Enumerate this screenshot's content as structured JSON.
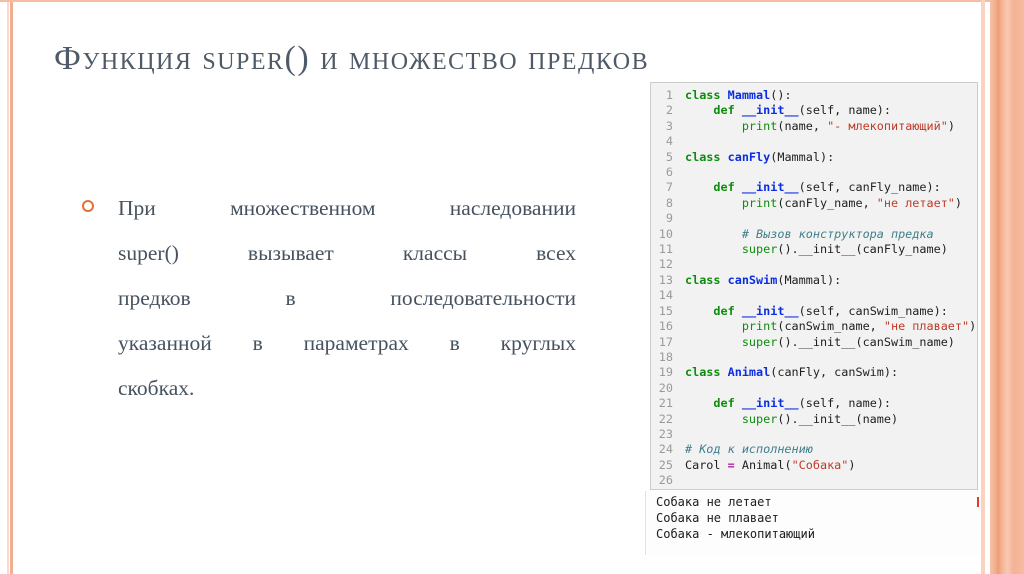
{
  "slide": {
    "title": "Функция super() и множество предков",
    "bullet": {
      "lines": [
        "При множественном наследовании",
        "super() вызывает классы всех",
        "предков в последовательности",
        "указанной в параметрах в круглых",
        "скобках."
      ]
    }
  },
  "code_panel": {
    "lines": [
      {
        "n": "1",
        "tokens": [
          {
            "t": "class",
            "c": "kw"
          },
          {
            "t": " ",
            "c": "pl"
          },
          {
            "t": "Mammal",
            "c": "cls"
          },
          {
            "t": "():",
            "c": "pl"
          }
        ]
      },
      {
        "n": "2",
        "tokens": [
          {
            "t": "    ",
            "c": "pl"
          },
          {
            "t": "def",
            "c": "kw"
          },
          {
            "t": " ",
            "c": "pl"
          },
          {
            "t": "__init__",
            "c": "fn"
          },
          {
            "t": "(self, name):",
            "c": "pl"
          }
        ]
      },
      {
        "n": "3",
        "tokens": [
          {
            "t": "        ",
            "c": "pl"
          },
          {
            "t": "print",
            "c": "bi"
          },
          {
            "t": "(name, ",
            "c": "pl"
          },
          {
            "t": "\"- млекопитающий\"",
            "c": "str"
          },
          {
            "t": ")",
            "c": "pl"
          }
        ]
      },
      {
        "n": "4",
        "tokens": []
      },
      {
        "n": "5",
        "tokens": [
          {
            "t": "class",
            "c": "kw"
          },
          {
            "t": " ",
            "c": "pl"
          },
          {
            "t": "canFly",
            "c": "cls"
          },
          {
            "t": "(Mammal):",
            "c": "pl"
          }
        ]
      },
      {
        "n": "6",
        "tokens": []
      },
      {
        "n": "7",
        "tokens": [
          {
            "t": "    ",
            "c": "pl"
          },
          {
            "t": "def",
            "c": "kw"
          },
          {
            "t": " ",
            "c": "pl"
          },
          {
            "t": "__init__",
            "c": "fn"
          },
          {
            "t": "(self, canFly_name):",
            "c": "pl"
          }
        ]
      },
      {
        "n": "8",
        "tokens": [
          {
            "t": "        ",
            "c": "pl"
          },
          {
            "t": "print",
            "c": "bi"
          },
          {
            "t": "(canFly_name, ",
            "c": "pl"
          },
          {
            "t": "\"не летает\"",
            "c": "str"
          },
          {
            "t": ")",
            "c": "pl"
          }
        ]
      },
      {
        "n": "9",
        "tokens": []
      },
      {
        "n": "10",
        "tokens": [
          {
            "t": "        ",
            "c": "pl"
          },
          {
            "t": "# Вызов конструктора предка",
            "c": "com"
          }
        ]
      },
      {
        "n": "11",
        "tokens": [
          {
            "t": "        ",
            "c": "pl"
          },
          {
            "t": "super",
            "c": "bi"
          },
          {
            "t": "().__init__(canFly_name)",
            "c": "pl"
          }
        ]
      },
      {
        "n": "12",
        "tokens": []
      },
      {
        "n": "13",
        "tokens": [
          {
            "t": "class",
            "c": "kw"
          },
          {
            "t": " ",
            "c": "pl"
          },
          {
            "t": "canSwim",
            "c": "cls"
          },
          {
            "t": "(Mammal):",
            "c": "pl"
          }
        ]
      },
      {
        "n": "14",
        "tokens": []
      },
      {
        "n": "15",
        "tokens": [
          {
            "t": "    ",
            "c": "pl"
          },
          {
            "t": "def",
            "c": "kw"
          },
          {
            "t": " ",
            "c": "pl"
          },
          {
            "t": "__init__",
            "c": "fn"
          },
          {
            "t": "(self, canSwim_name):",
            "c": "pl"
          }
        ]
      },
      {
        "n": "16",
        "tokens": [
          {
            "t": "        ",
            "c": "pl"
          },
          {
            "t": "print",
            "c": "bi"
          },
          {
            "t": "(canSwim_name, ",
            "c": "pl"
          },
          {
            "t": "\"не плавает\"",
            "c": "str"
          },
          {
            "t": ")",
            "c": "pl"
          }
        ]
      },
      {
        "n": "17",
        "tokens": [
          {
            "t": "        ",
            "c": "pl"
          },
          {
            "t": "super",
            "c": "bi"
          },
          {
            "t": "().__init__(canSwim_name)",
            "c": "pl"
          }
        ]
      },
      {
        "n": "18",
        "tokens": []
      },
      {
        "n": "19",
        "tokens": [
          {
            "t": "class",
            "c": "kw"
          },
          {
            "t": " ",
            "c": "pl"
          },
          {
            "t": "Animal",
            "c": "cls"
          },
          {
            "t": "(canFly, canSwim):",
            "c": "pl"
          }
        ]
      },
      {
        "n": "20",
        "tokens": []
      },
      {
        "n": "21",
        "tokens": [
          {
            "t": "    ",
            "c": "pl"
          },
          {
            "t": "def",
            "c": "kw"
          },
          {
            "t": " ",
            "c": "pl"
          },
          {
            "t": "__init__",
            "c": "fn"
          },
          {
            "t": "(self, name):",
            "c": "pl"
          }
        ]
      },
      {
        "n": "22",
        "tokens": [
          {
            "t": "        ",
            "c": "pl"
          },
          {
            "t": "super",
            "c": "bi"
          },
          {
            "t": "().__init__(name)",
            "c": "pl"
          }
        ]
      },
      {
        "n": "23",
        "tokens": []
      },
      {
        "n": "24",
        "tokens": [
          {
            "t": "# Код к исполнению",
            "c": "com"
          }
        ]
      },
      {
        "n": "25",
        "tokens": [
          {
            "t": "Carol ",
            "c": "pl"
          },
          {
            "t": "=",
            "c": "op"
          },
          {
            "t": " Animal(",
            "c": "pl"
          },
          {
            "t": "\"Собака\"",
            "c": "str"
          },
          {
            "t": ")",
            "c": "pl"
          }
        ]
      },
      {
        "n": "26",
        "tokens": []
      }
    ]
  },
  "output_panel": {
    "lines": [
      "Собака не летает",
      "Собака не плавает",
      "Собака - млекопитающий"
    ]
  },
  "colors": {
    "accent_salmon": "#f3ad90",
    "accent_salmon_light": "#f9d9ca",
    "title_text": "#4e5a67",
    "body_text": "#46525f",
    "bullet_marker": "#e2703a",
    "code_background": "#f2f2f2",
    "code_keyword": "#0e8c0e",
    "code_class_name": "#0b2ee0",
    "code_string": "#c03a28",
    "code_comment": "#40808c",
    "code_operator": "#b12ba0",
    "line_number": "#9a9a9a",
    "output_scroll_mark": "#e23c28"
  }
}
